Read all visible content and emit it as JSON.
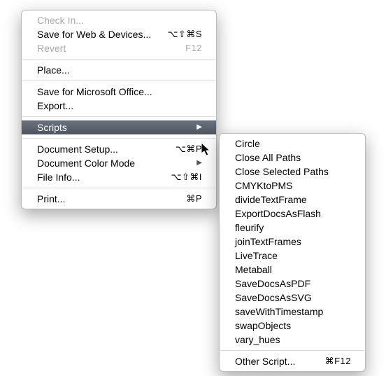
{
  "mainMenu": {
    "sections": [
      [
        {
          "label": "Check In...",
          "shortcut": "",
          "disabled": true,
          "submenu": false
        },
        {
          "label": "Save for Web & Devices...",
          "shortcut": "⌥⇧⌘S",
          "disabled": false,
          "submenu": false
        },
        {
          "label": "Revert",
          "shortcut": "F12",
          "disabled": true,
          "submenu": false
        }
      ],
      [
        {
          "label": "Place...",
          "shortcut": "",
          "disabled": false,
          "submenu": false
        }
      ],
      [
        {
          "label": "Save for Microsoft Office...",
          "shortcut": "",
          "disabled": false,
          "submenu": false
        },
        {
          "label": "Export...",
          "shortcut": "",
          "disabled": false,
          "submenu": false
        }
      ],
      [
        {
          "label": "Scripts",
          "shortcut": "",
          "disabled": false,
          "submenu": true,
          "selected": true
        }
      ],
      [
        {
          "label": "Document Setup...",
          "shortcut": "⌥⌘P",
          "disabled": false,
          "submenu": false
        },
        {
          "label": "Document Color Mode",
          "shortcut": "",
          "disabled": false,
          "submenu": true
        },
        {
          "label": "File Info...",
          "shortcut": "⌥⇧⌘I",
          "disabled": false,
          "submenu": false
        }
      ],
      [
        {
          "label": "Print...",
          "shortcut": "⌘P",
          "disabled": false,
          "submenu": false
        }
      ]
    ]
  },
  "subMenu": {
    "sections": [
      [
        {
          "label": "Circle"
        },
        {
          "label": "Close All Paths"
        },
        {
          "label": "Close Selected Paths"
        },
        {
          "label": "CMYKtoPMS"
        },
        {
          "label": "divideTextFrame"
        },
        {
          "label": "ExportDocsAsFlash"
        },
        {
          "label": "fleurify"
        },
        {
          "label": "joinTextFrames"
        },
        {
          "label": "LiveTrace"
        },
        {
          "label": "Metaball"
        },
        {
          "label": "SaveDocsAsPDF"
        },
        {
          "label": "SaveDocsAsSVG"
        },
        {
          "label": "saveWithTimestamp"
        },
        {
          "label": "swapObjects"
        },
        {
          "label": "vary_hues"
        }
      ],
      [
        {
          "label": "Other Script...",
          "shortcut": "⌘F12"
        }
      ]
    ]
  }
}
